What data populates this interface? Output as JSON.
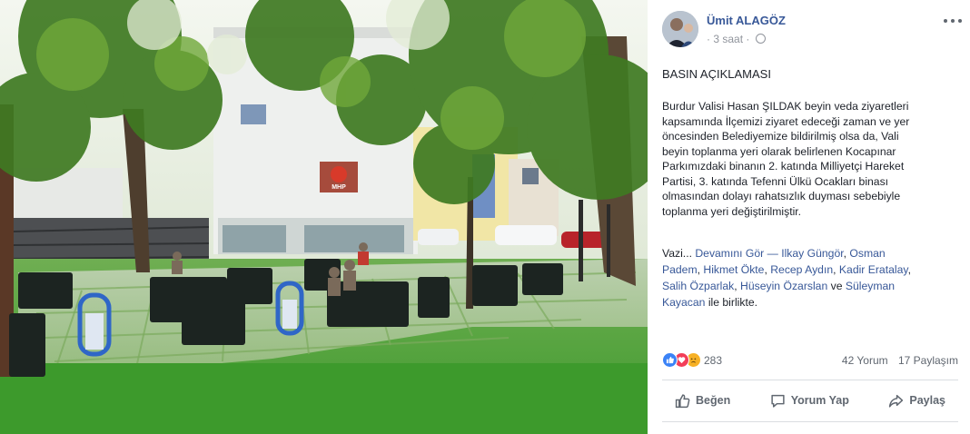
{
  "post": {
    "author": "Ümit ALAGÖZ",
    "time": "3 saat",
    "dot": "·",
    "title": "BASIN AÇIKLAMASI",
    "body_lines": [
      "Burdur Valisi Hasan ŞILDAK beyin veda ziyaretleri",
      "kapsamında İlçemizi ziyaret edeceği zaman ve yer",
      "öncesinden Belediyemize bildirilmiş olsa da, Vali",
      "beyin toplanma yeri olarak belirlenen Kocapınar",
      "Parkımızdaki binanın 2. katında Milliyetçi Hareket",
      "Partisi, 3. katında Tefenni Ülkü Ocakları binası",
      "olmasından dolayı rahatsızlık duyması sebebiyle",
      "toplanma yeri değiştirilmiştir."
    ],
    "tags": {
      "prefix": "Vazi...",
      "see_more": "Devamını Gör",
      "dash": "—",
      "people": [
        "Ilkay Güngör",
        "Osman",
        "Padem",
        "Hikmet Ökte",
        "Recep Aydın",
        "Kadir Eratalay",
        "Salih Özparlak",
        "Hüseyin Özarslan",
        "Süleyman",
        "Kayacan"
      ],
      "and": "ve",
      "with": "ile birlikte."
    }
  },
  "reactions": {
    "count": "283",
    "comments": "42 Yorum",
    "shares": "17 Paylaşım",
    "icons": [
      "like-icon",
      "love-icon",
      "sad-icon"
    ]
  },
  "actions": {
    "like": "Beğen",
    "comment": "Yorum Yap",
    "share": "Paylaş"
  },
  "sign": {
    "party": "MHP"
  },
  "colors": {
    "link": "#385898",
    "muted": "#606770",
    "like": "#3b82f6",
    "love": "#f33e58",
    "sad": "#f7b125"
  }
}
